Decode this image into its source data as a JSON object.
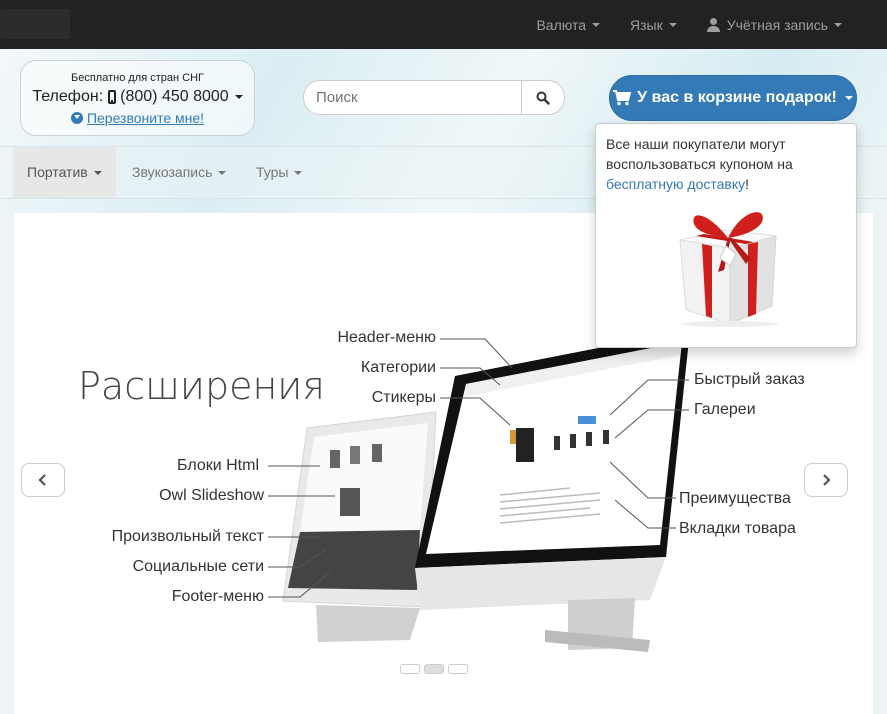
{
  "topbar": {
    "menu": [
      {
        "label": "Валюта",
        "icon": "caret-down-icon"
      },
      {
        "label": "Язык",
        "icon": "caret-down-icon"
      },
      {
        "label": "Учётная запись",
        "icon": "user-icon"
      }
    ]
  },
  "header": {
    "phone_box": {
      "small_text": "Бесплатно для стран СНГ",
      "phone_label": "Телефон:",
      "phone_number": "(800) 450 8000",
      "callback_link": "Перезвоните мне!"
    },
    "search": {
      "placeholder": "Поиск"
    },
    "cart_button": "У вас в корзине подарок!"
  },
  "nav": {
    "items": [
      {
        "label": "Портатив",
        "active": true
      },
      {
        "label": "Звукозапись",
        "active": false
      },
      {
        "label": "Туры",
        "active": false
      }
    ]
  },
  "cart_dropdown": {
    "text_line1": "Все наши покупатели могут",
    "text_line2": "воспользоваться купоном на",
    "link": "бесплатную доставку",
    "text_end": "!"
  },
  "slide": {
    "title": "Расширения",
    "left_labels": [
      "Блоки Html",
      "Owl Slideshow",
      "Произвольный текст",
      "Социальные сети",
      "Footer-меню"
    ],
    "top_labels": [
      "Header-меню",
      "Категории",
      "Стикеры"
    ],
    "right_labels": [
      "Быстрый заказ",
      "Галереи",
      "Преимущества",
      "Вкладки товара"
    ]
  },
  "carousel": {
    "slide_count": 3,
    "active_index": 1
  },
  "colors": {
    "primary": "#337ab7",
    "topbar": "#222222",
    "gift_ribbon": "#d0201e"
  }
}
